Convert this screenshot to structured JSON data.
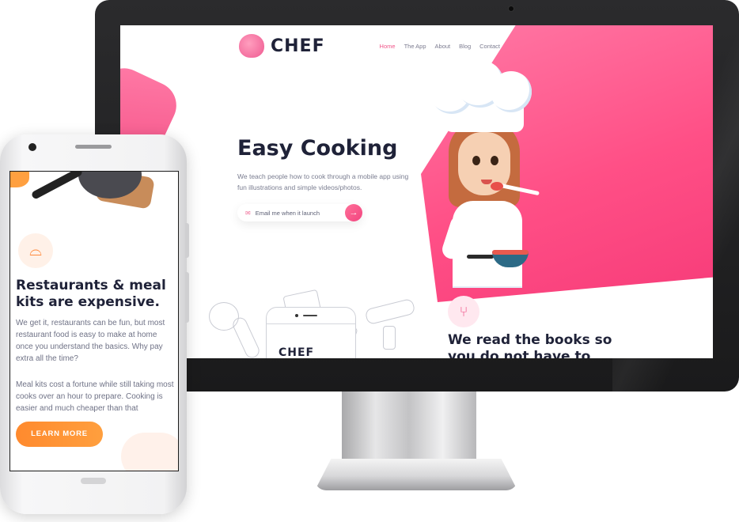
{
  "desktop": {
    "brand": "CHEF",
    "nav": [
      {
        "label": "Home",
        "active": true
      },
      {
        "label": "The App",
        "active": false
      },
      {
        "label": "About",
        "active": false
      },
      {
        "label": "Blog",
        "active": false
      },
      {
        "label": "Contact",
        "active": false
      }
    ],
    "hero": {
      "title": "Easy Cooking",
      "subtitle": "We teach people how to cook through a mobile app using fun illustrations and simple videos/photos.",
      "email_placeholder": "Email me when it launch",
      "submit_icon": "arrow-right-icon"
    },
    "feature": {
      "icon": "utensils-icon",
      "title": "We read the books so you do not have to"
    },
    "sketch_brand": "CHEF",
    "accent_color": "#f0568a"
  },
  "mobile": {
    "icon": "cloche-icon",
    "title": "Restaurants & meal kits are expensive.",
    "paragraph1": "We get it, restaurants can be fun, but most restaurant food is easy to make at home once you understand the basics. Why pay extra all the time?",
    "paragraph2": "Meal kits cost a fortune while still taking most cooks over an hour to prepare. Cooking is easier and much cheaper than that",
    "cta": "LEARN MORE",
    "accent_color": "#ff8a2e"
  }
}
